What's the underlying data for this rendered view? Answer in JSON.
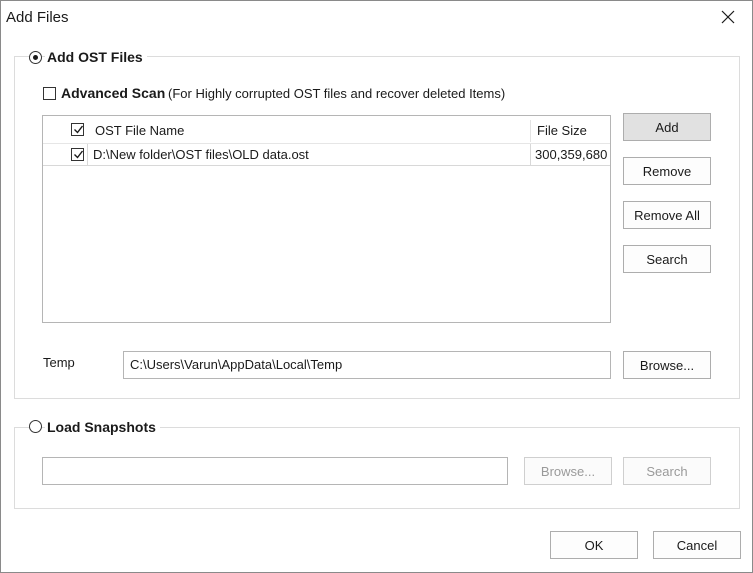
{
  "window": {
    "title": "Add Files",
    "close_glyph": "✕"
  },
  "ost_group": {
    "title": "Add OST Files",
    "selected": true,
    "advanced_scan": {
      "label": "Advanced Scan",
      "description": "(For Highly corrupted OST files and recover deleted Items)",
      "checked": false
    },
    "list": {
      "columns": [
        "OST File Name",
        "File Size"
      ],
      "header_checked": true,
      "rows": [
        {
          "checked": true,
          "name": "D:\\New folder\\OST files\\OLD data.ost",
          "size": "300,359,680"
        }
      ]
    },
    "buttons": {
      "add": "Add",
      "remove": "Remove",
      "remove_all": "Remove All",
      "search": "Search"
    },
    "temp": {
      "label": "Temp",
      "value": "C:\\Users\\Varun\\AppData\\Local\\Temp",
      "browse": "Browse..."
    }
  },
  "snapshots_group": {
    "title": "Load Snapshots",
    "selected": false,
    "path_value": "",
    "browse": "Browse...",
    "search": "Search"
  },
  "footer": {
    "ok": "OK",
    "cancel": "Cancel"
  }
}
